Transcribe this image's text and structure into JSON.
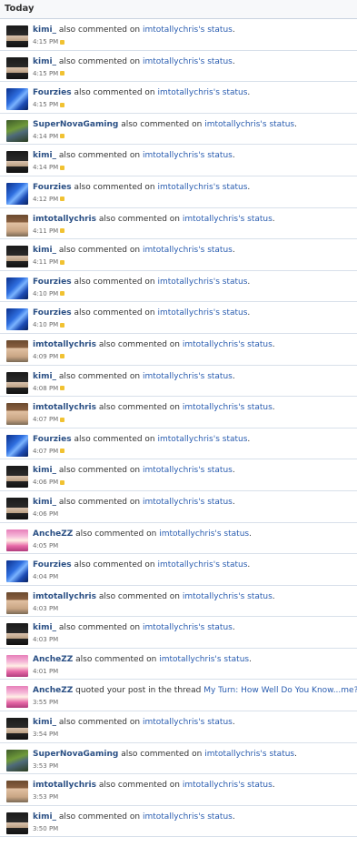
{
  "header": {
    "title": "Today"
  },
  "items": [
    {
      "user": "kimi_",
      "avatar": "kimi",
      "action": "also commented on",
      "target": "imtotallychris's status",
      "suffix": ".",
      "time": "4:15 PM",
      "unread": true
    },
    {
      "user": "kimi_",
      "avatar": "kimi",
      "action": "also commented on",
      "target": "imtotallychris's status",
      "suffix": ".",
      "time": "4:15 PM",
      "unread": true
    },
    {
      "user": "Fourzies",
      "avatar": "fourzies",
      "action": "also commented on",
      "target": "imtotallychris's status",
      "suffix": ".",
      "time": "4:15 PM",
      "unread": true
    },
    {
      "user": "SuperNovaGaming",
      "avatar": "supernova",
      "action": "also commented on",
      "target": "imtotallychris's status",
      "suffix": ".",
      "time": "4:14 PM",
      "unread": true
    },
    {
      "user": "kimi_",
      "avatar": "kimi",
      "action": "also commented on",
      "target": "imtotallychris's status",
      "suffix": ".",
      "time": "4:14 PM",
      "unread": true
    },
    {
      "user": "Fourzies",
      "avatar": "fourzies",
      "action": "also commented on",
      "target": "imtotallychris's status",
      "suffix": ".",
      "time": "4:12 PM",
      "unread": true
    },
    {
      "user": "imtotallychris",
      "avatar": "imtotally",
      "action": "also commented on",
      "target": "imtotallychris's status",
      "suffix": ".",
      "time": "4:11 PM",
      "unread": true
    },
    {
      "user": "kimi_",
      "avatar": "kimi",
      "action": "also commented on",
      "target": "imtotallychris's status",
      "suffix": ".",
      "time": "4:11 PM",
      "unread": true
    },
    {
      "user": "Fourzies",
      "avatar": "fourzies",
      "action": "also commented on",
      "target": "imtotallychris's status",
      "suffix": ".",
      "time": "4:10 PM",
      "unread": true
    },
    {
      "user": "Fourzies",
      "avatar": "fourzies",
      "action": "also commented on",
      "target": "imtotallychris's status",
      "suffix": ".",
      "time": "4:10 PM",
      "unread": true
    },
    {
      "user": "imtotallychris",
      "avatar": "imtotally",
      "action": "also commented on",
      "target": "imtotallychris's status",
      "suffix": ".",
      "time": "4:09 PM",
      "unread": true
    },
    {
      "user": "kimi_",
      "avatar": "kimi",
      "action": "also commented on",
      "target": "imtotallychris's status",
      "suffix": ".",
      "time": "4:08 PM",
      "unread": true
    },
    {
      "user": "imtotallychris",
      "avatar": "imtotally",
      "action": "also commented on",
      "target": "imtotallychris's status",
      "suffix": ".",
      "time": "4:07 PM",
      "unread": true
    },
    {
      "user": "Fourzies",
      "avatar": "fourzies",
      "action": "also commented on",
      "target": "imtotallychris's status",
      "suffix": ".",
      "time": "4:07 PM",
      "unread": true
    },
    {
      "user": "kimi_",
      "avatar": "kimi",
      "action": "also commented on",
      "target": "imtotallychris's status",
      "suffix": ".",
      "time": "4:06 PM",
      "unread": true
    },
    {
      "user": "kimi_",
      "avatar": "kimi",
      "action": "also commented on",
      "target": "imtotallychris's status",
      "suffix": ".",
      "time": "4:06 PM",
      "unread": false
    },
    {
      "user": "AncheZZ",
      "avatar": "anchezz",
      "action": "also commented on",
      "target": "imtotallychris's status",
      "suffix": ".",
      "time": "4:05 PM",
      "unread": false
    },
    {
      "user": "Fourzies",
      "avatar": "fourzies",
      "action": "also commented on",
      "target": "imtotallychris's status",
      "suffix": ".",
      "time": "4:04 PM",
      "unread": false
    },
    {
      "user": "imtotallychris",
      "avatar": "imtotally",
      "action": "also commented on",
      "target": "imtotallychris's status",
      "suffix": ".",
      "time": "4:03 PM",
      "unread": false
    },
    {
      "user": "kimi_",
      "avatar": "kimi",
      "action": "also commented on",
      "target": "imtotallychris's status",
      "suffix": ".",
      "time": "4:03 PM",
      "unread": false
    },
    {
      "user": "AncheZZ",
      "avatar": "anchezz",
      "action": "also commented on",
      "target": "imtotallychris's status",
      "suffix": ".",
      "time": "4:01 PM",
      "unread": false
    },
    {
      "user": "AncheZZ",
      "avatar": "anchezz",
      "action": "quoted your post in the thread",
      "target": "My Turn: How Well Do You Know...me?",
      "suffix": ".",
      "time": "3:55 PM",
      "unread": false
    },
    {
      "user": "kimi_",
      "avatar": "kimi",
      "action": "also commented on",
      "target": "imtotallychris's status",
      "suffix": ".",
      "time": "3:54 PM",
      "unread": false
    },
    {
      "user": "SuperNovaGaming",
      "avatar": "supernova",
      "action": "also commented on",
      "target": "imtotallychris's status",
      "suffix": ".",
      "time": "3:53 PM",
      "unread": false
    },
    {
      "user": "imtotallychris",
      "avatar": "imtotally",
      "action": "also commented on",
      "target": "imtotallychris's status",
      "suffix": ".",
      "time": "3:53 PM",
      "unread": false
    },
    {
      "user": "kimi_",
      "avatar": "kimi",
      "action": "also commented on",
      "target": "imtotallychris's status",
      "suffix": ".",
      "time": "3:50 PM",
      "unread": false
    }
  ]
}
